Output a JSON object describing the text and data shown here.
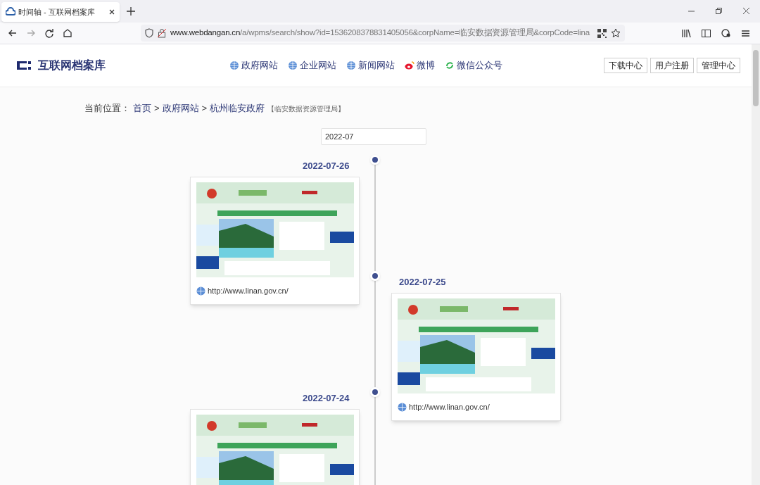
{
  "browser": {
    "tabs": [
      {
        "title": "时间轴 - 互联网档案库",
        "selected": true
      }
    ],
    "address": {
      "host": "www.webdangan.cn",
      "rest": "/a/wpms/search/show?id=1536208378831405056&corpName=临安数据资源管理局&corpCode=lina"
    }
  },
  "header": {
    "logo": "互联网档案库",
    "nav": [
      {
        "label": "政府网站",
        "kind": "globe"
      },
      {
        "label": "企业网站",
        "kind": "globe"
      },
      {
        "label": "新闻网站",
        "kind": "globe"
      },
      {
        "label": "微博",
        "kind": "weibo"
      },
      {
        "label": "微信公众号",
        "kind": "wechat"
      }
    ],
    "buttons": [
      "下载中心",
      "用户注册",
      "管理中心"
    ]
  },
  "breadcrumb": {
    "label": "当前位置：",
    "items": [
      "首页",
      "政府网站",
      "杭州临安政府"
    ],
    "separators": [
      ">",
      ">"
    ],
    "note": "【临安数据资源管理局】"
  },
  "month_field": {
    "value": "2022-07"
  },
  "timeline": [
    {
      "date": "2022-07-26",
      "url": "http://www.linan.gov.cn/"
    },
    {
      "date": "2022-07-25",
      "url": "http://www.linan.gov.cn/"
    },
    {
      "date": "2022-07-24"
    }
  ]
}
